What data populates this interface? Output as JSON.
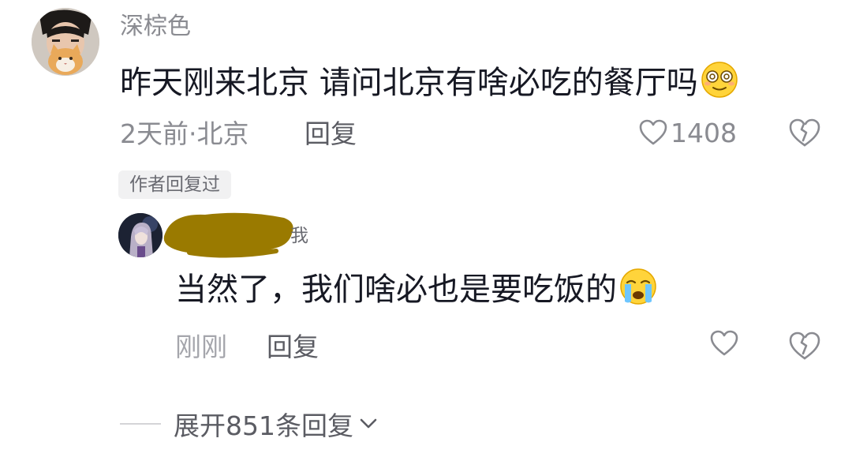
{
  "comment": {
    "username": "深棕色",
    "text": "昨天刚来北京 请问北京有啥必吃的餐厅吗",
    "emoji": "dizzy-face-emoji",
    "meta": "2天前·北京",
    "reply_label": "回复",
    "like_count": "1408"
  },
  "author_badge": "作者回复过",
  "reply": {
    "me_label": "我",
    "text": "当然了，我们啥必也是要吃饭的",
    "emoji": "crying-face-emoji",
    "meta": "刚刚",
    "reply_label": "回复"
  },
  "expand": {
    "label": "展开851条回复"
  },
  "colors": {
    "text_primary": "#161823",
    "text_secondary": "#8a8b91",
    "redaction": "#9a7a00"
  }
}
